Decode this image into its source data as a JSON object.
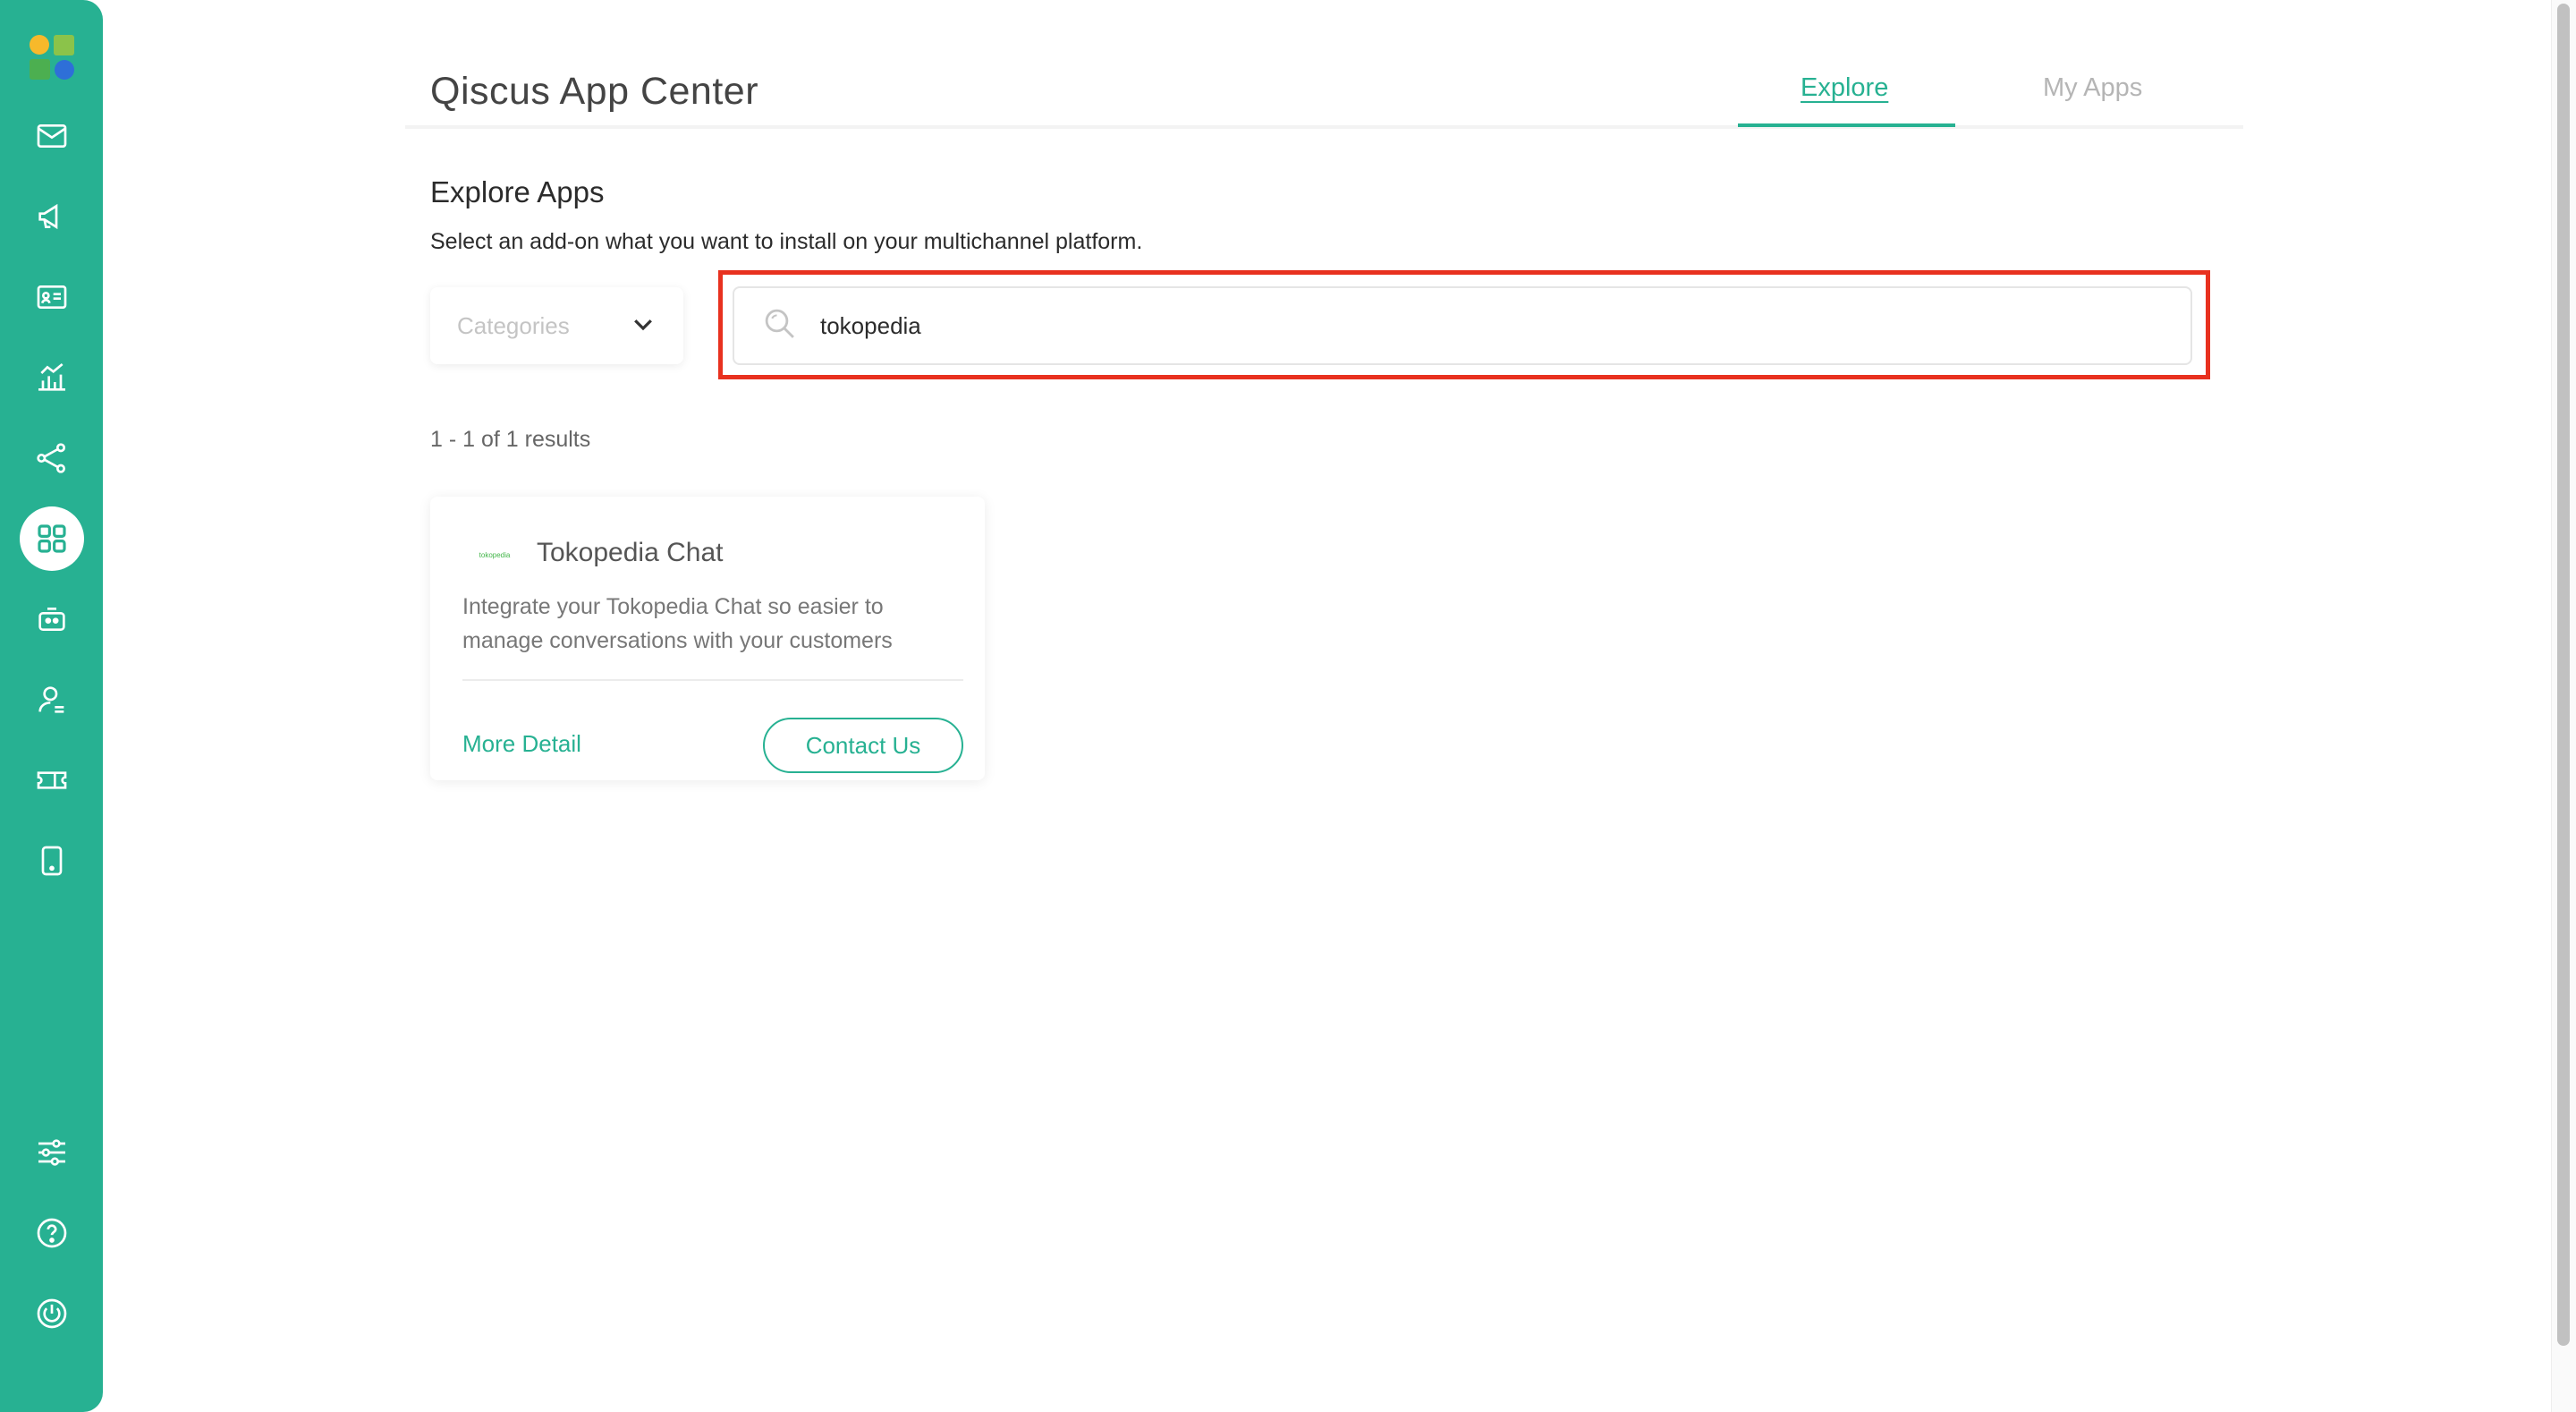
{
  "sidebar": {
    "icons": [
      "app-logo",
      "inbox-icon",
      "broadcast-icon",
      "contact-card-icon",
      "analytics-icon",
      "integration-icon",
      "app-center-icon",
      "bot-icon",
      "agent-icon",
      "ticket-icon",
      "mobile-icon",
      "settings-sliders-icon",
      "help-icon",
      "power-icon"
    ],
    "active": "app-center-icon",
    "color": "#27b192"
  },
  "header": {
    "title": "Qiscus App Center",
    "tabs": [
      {
        "label": "Explore",
        "active": true
      },
      {
        "label": "My Apps",
        "active": false
      }
    ]
  },
  "main": {
    "section_title": "Explore Apps",
    "section_desc": "Select an add-on what you want to install on your multichannel platform.",
    "categories_placeholder": "Categories",
    "search_value": "tokopedia",
    "results_text": "1 - 1 of 1 results",
    "apps": [
      {
        "logo_text": "tokopedia",
        "name": "Tokopedia Chat",
        "description": "Integrate your Tokopedia Chat so easier to manage conversations with your customers",
        "more_label": "More Detail",
        "action_label": "Contact Us"
      }
    ]
  },
  "colors": {
    "accent": "#27b192",
    "highlight": "#e8311f"
  }
}
